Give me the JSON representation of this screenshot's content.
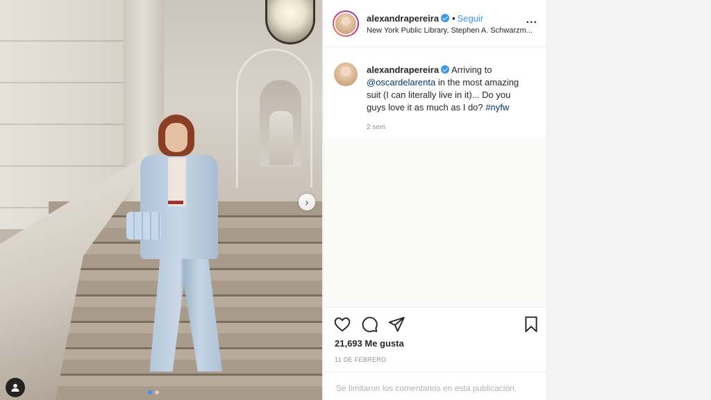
{
  "post": {
    "username": "alexandrapereira",
    "separator": "•",
    "follow_label": "Seguir",
    "location": "New York Public Library, Stephen A. Schwarzm...",
    "more_label": "...",
    "caption_username": "alexandrapereira",
    "caption_text_1": " Arriving to ",
    "caption_mention": "@oscardelarenta",
    "caption_text_2": " in the most amazing suit (I can literally live in it)... Do you guys love it as much as I do? ",
    "caption_hashtag": "#nyfw",
    "caption_time": "2 sem",
    "likes": "21,693 Me gusta",
    "date": "11 DE FEBRERO",
    "comments_disabled": "Se limitaron los comentarios en esta publicación."
  },
  "carousel": {
    "next_label": "›",
    "slide_count": 2,
    "active_slide": 1
  },
  "icons": {
    "like": "heart-icon",
    "comment": "comment-icon",
    "share": "paper-plane-icon",
    "save": "bookmark-icon",
    "tag": "user-tag-icon",
    "verified": "verified-badge-icon"
  },
  "colors": {
    "accent": "#3897f0",
    "text": "#262626",
    "muted": "#8e8e8e",
    "link": "#00376b"
  }
}
